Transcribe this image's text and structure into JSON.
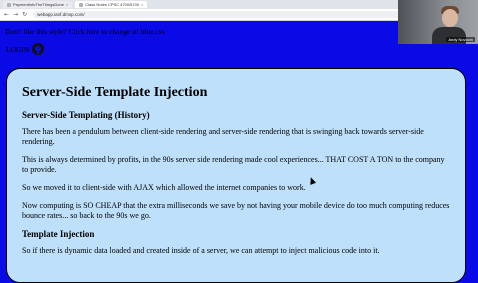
{
  "browser": {
    "tabs": [
      {
        "label": "PaymentInfoTheThingsDone",
        "active": false
      },
      {
        "label": "Class Notes CPSC 4700/5700",
        "active": true
      }
    ],
    "url": "webapp.ianf.dmsp.com/"
  },
  "page": {
    "style_link": "Don't like this style? Click here to change it! blue.css",
    "login_label": "LOGIN"
  },
  "article": {
    "title": "Server-Side Template Injection",
    "section1_heading": "Server-Side Templating (History)",
    "p1": "There has been a pendulum between client-side rendering and server-side rendering that is swinging back towards server-side rendering.",
    "p2": "This is always determined by profits, in the 90s server side rendering made cool experiences... THAT COST A TON to the company to provide.",
    "p3": "So we moved it to client-side with AJAX which allowed the internet companies to work.",
    "p4": "Now computing is SO CHEAP that the extra milliseconds we save by not having your mobile device do too much computing reduces bounce rates... so back to the 90s we go.",
    "section2_heading": "Template Injection",
    "p5": "So if there is dynamic data loaded and created inside of a server, we can attempt to inject malicious code into it."
  },
  "webcam": {
    "name": "Andy Novocin"
  },
  "colors": {
    "page_background": "#0a0ae6",
    "card_background": "#bfe0fb"
  }
}
